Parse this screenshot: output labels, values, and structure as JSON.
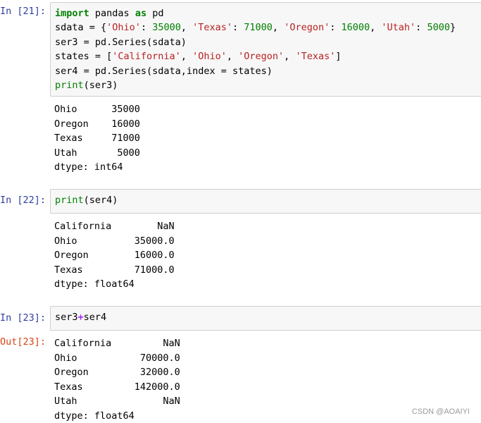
{
  "cells": [
    {
      "in_prompt": "In [21]:",
      "code": [
        [
          [
            "kw",
            "import"
          ],
          [
            "plain",
            " pandas "
          ],
          [
            "kw",
            "as"
          ],
          [
            "plain",
            " pd"
          ]
        ],
        [
          [
            "plain",
            "sdata = {"
          ],
          [
            "str",
            "'Ohio'"
          ],
          [
            "plain",
            ": "
          ],
          [
            "num",
            "35000"
          ],
          [
            "plain",
            ", "
          ],
          [
            "str",
            "'Texas'"
          ],
          [
            "plain",
            ": "
          ],
          [
            "num",
            "71000"
          ],
          [
            "plain",
            ", "
          ],
          [
            "str",
            "'Oregon'"
          ],
          [
            "plain",
            ": "
          ],
          [
            "num",
            "16000"
          ],
          [
            "plain",
            ", "
          ],
          [
            "str",
            "'Utah'"
          ],
          [
            "plain",
            ": "
          ],
          [
            "num",
            "5000"
          ],
          [
            "plain",
            "}"
          ]
        ],
        [
          [
            "plain",
            "ser3 = pd.Series(sdata)"
          ]
        ],
        [
          [
            "plain",
            "states = ["
          ],
          [
            "str",
            "'California'"
          ],
          [
            "plain",
            ", "
          ],
          [
            "str",
            "'Ohio'"
          ],
          [
            "plain",
            ", "
          ],
          [
            "str",
            "'Oregon'"
          ],
          [
            "plain",
            ", "
          ],
          [
            "str",
            "'Texas'"
          ],
          [
            "plain",
            "]"
          ]
        ],
        [
          [
            "plain",
            "ser4 = pd.Series(sdata,index = states)"
          ]
        ],
        [
          [
            "bi",
            "print"
          ],
          [
            "plain",
            "(ser3)"
          ]
        ]
      ],
      "output": [
        "Ohio      35000",
        "Oregon    16000",
        "Texas     71000",
        "Utah       5000",
        "dtype: int64"
      ]
    },
    {
      "in_prompt": "In [22]:",
      "code": [
        [
          [
            "bi",
            "print"
          ],
          [
            "plain",
            "(ser4)"
          ]
        ]
      ],
      "output": [
        "California        NaN",
        "Ohio          35000.0",
        "Oregon        16000.0",
        "Texas         71000.0",
        "dtype: float64"
      ]
    },
    {
      "in_prompt": "In [23]:",
      "out_prompt": "Out[23]:",
      "code": [
        [
          [
            "plain",
            "ser3"
          ],
          [
            "op",
            "+"
          ],
          [
            "plain",
            "ser4"
          ]
        ]
      ],
      "output": [
        "California         NaN",
        "Ohio           70000.0",
        "Oregon         32000.0",
        "Texas         142000.0",
        "Utah               NaN",
        "dtype: float64"
      ]
    }
  ],
  "watermark": "CSDN @AOAIYI"
}
